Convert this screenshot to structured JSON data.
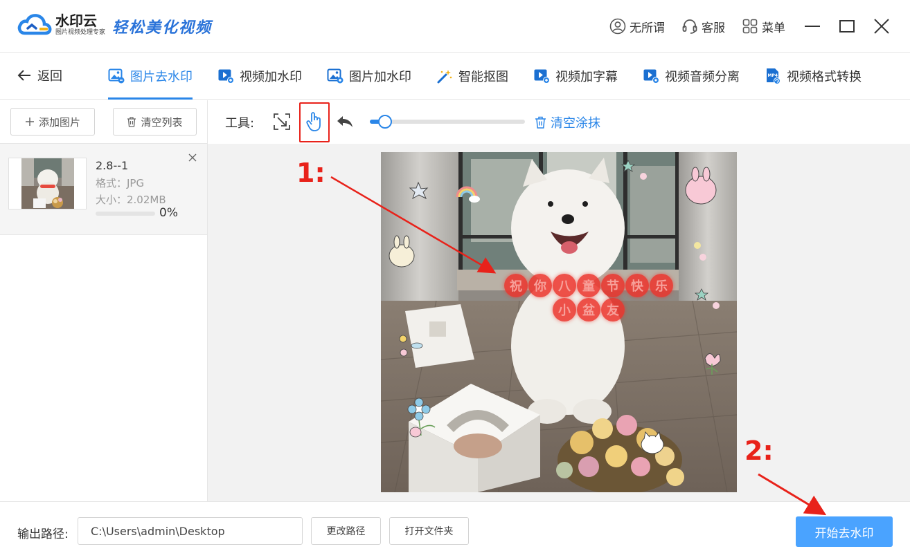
{
  "app": {
    "name": "水印云",
    "subtitle": "图片视频处理专家",
    "slogan": "轻松美化视频",
    "user": "无所谓",
    "service": "客服",
    "menu": "菜单"
  },
  "nav": {
    "back": "返回",
    "tabs": [
      {
        "label": "图片去水印",
        "active": true
      },
      {
        "label": "视频加水印",
        "active": false
      },
      {
        "label": "图片加水印",
        "active": false
      },
      {
        "label": "智能抠图",
        "active": false
      },
      {
        "label": "视频加字幕",
        "active": false
      },
      {
        "label": "视频音频分离",
        "active": false
      },
      {
        "label": "视频格式转换",
        "active": false
      }
    ]
  },
  "sidebar": {
    "add_label": "添加图片",
    "clear_label": "清空列表",
    "file": {
      "name": "2.8--1",
      "format": "格式：JPG",
      "size": "大小：2.02MB",
      "progress": 0,
      "progress_text": "0%"
    }
  },
  "toolbar": {
    "label": "工具:",
    "slider_value": 0.1,
    "clear_label": "清空涂抹"
  },
  "image": {
    "banner_line1": [
      "祝",
      "你",
      "八",
      "童",
      "节",
      "快",
      "乐"
    ],
    "banner_line2": [
      "小",
      "盆",
      "友"
    ]
  },
  "annotations": {
    "step1": "1:",
    "step2": "2:",
    "color": "#e8221a"
  },
  "bottom": {
    "output_label": "输出路径:",
    "output_path": "C:\\Users\\admin\\Desktop",
    "change_path": "更改路径",
    "open_folder": "打开文件夹",
    "start": "开始去水印"
  },
  "colors": {
    "accent": "#2a86e8",
    "start_button": "#4aa3ff"
  }
}
